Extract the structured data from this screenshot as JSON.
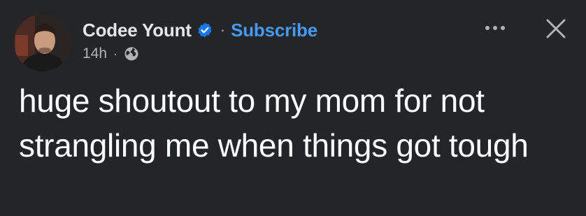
{
  "post": {
    "author": {
      "name": "Codee Yount",
      "verified_icon": "verified-badge-icon",
      "avatar_icon": "profile-photo"
    },
    "separator": "·",
    "subscribe_label": "Subscribe",
    "timestamp": "14h",
    "meta_separator": "·",
    "audience_icon": "globe-icon",
    "more_icon": "more-options-icon",
    "close_icon": "close-icon",
    "text": "huge shoutout to my mom for not strangling me when things got tough"
  },
  "colors": {
    "background": "#242526",
    "primary_text": "#e4e6eb",
    "secondary_text": "#b0b3b8",
    "link": "#4599ff",
    "verified": "#1877f2"
  }
}
